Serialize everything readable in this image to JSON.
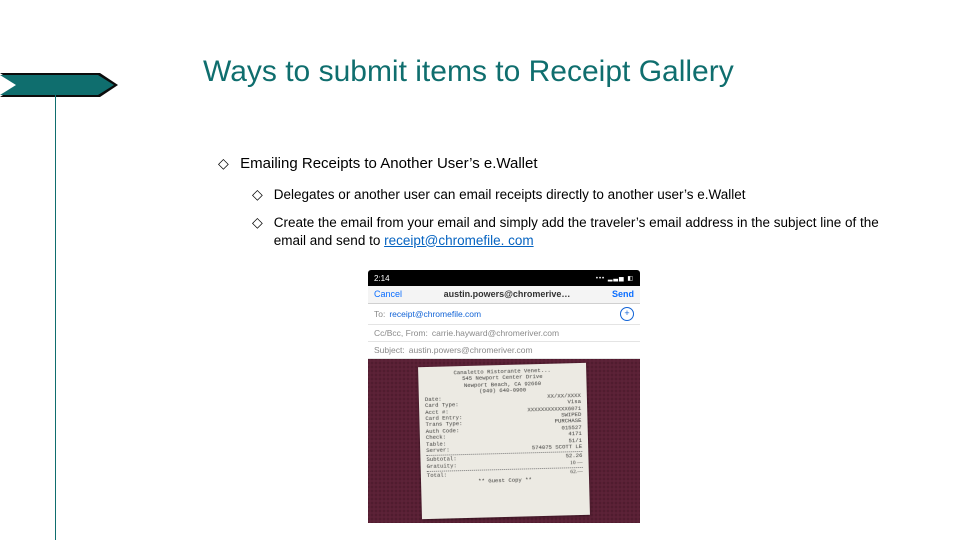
{
  "title": "Ways to submit items to Receipt Gallery",
  "bullets": {
    "section": "Emailing Receipts to Another User’s e.Wallet",
    "items": [
      "Delegates or another user can email receipts directly to another user’s e.Wallet",
      "Create the email from your email and simply add the traveler’s email address in the subject line of the email and send to "
    ],
    "link": "receipt@chromefile. com",
    "marker": "◇"
  },
  "phone": {
    "status_time": "2:14",
    "cancel": "Cancel",
    "sender": "austin.powers@chromerive…",
    "send": "Send",
    "to_label": "To:",
    "to_value": "receipt@chromefile.com",
    "cc_label": "Cc/Bcc, From:",
    "cc_value": "carrie.hayward@chromeriver.com",
    "subject_label": "Subject:",
    "subject_value": "austin.powers@chromeriver.com"
  },
  "receipt": {
    "l1": "Canaletto Ristorante Venet...",
    "l2": "545 Newport Center Drive",
    "l3": "Newport Beach, CA  92660",
    "l4": "(949) 640-0900",
    "date_label": "Date:",
    "date_value": "XX/XX/XXXX",
    "card_label": "Card Type:",
    "card_value": "Visa",
    "acct_label": "Acct #:",
    "acct_value": "XXXXXXXXXXXX6071",
    "type_label": "Card Entry:",
    "type_value": "SWIPED",
    "trans_label": "Trans Type:",
    "trans_value": "PURCHASE",
    "auth_label": "Auth Code:",
    "auth_value": "015527",
    "check_label": "Check:",
    "check_value": "4171",
    "table_label": "Table:",
    "table_value": "51/1",
    "server_label": "Server:",
    "server_value": "574075 SCOTT LE",
    "subtotal_label": "Subtotal:",
    "subtotal_value": "52.26",
    "gratuity_label": "Gratuity:",
    "gratuity_value": "10 —",
    "total_label": "Total:",
    "total_value": "62.—",
    "footer": "** Guest Copy **"
  }
}
